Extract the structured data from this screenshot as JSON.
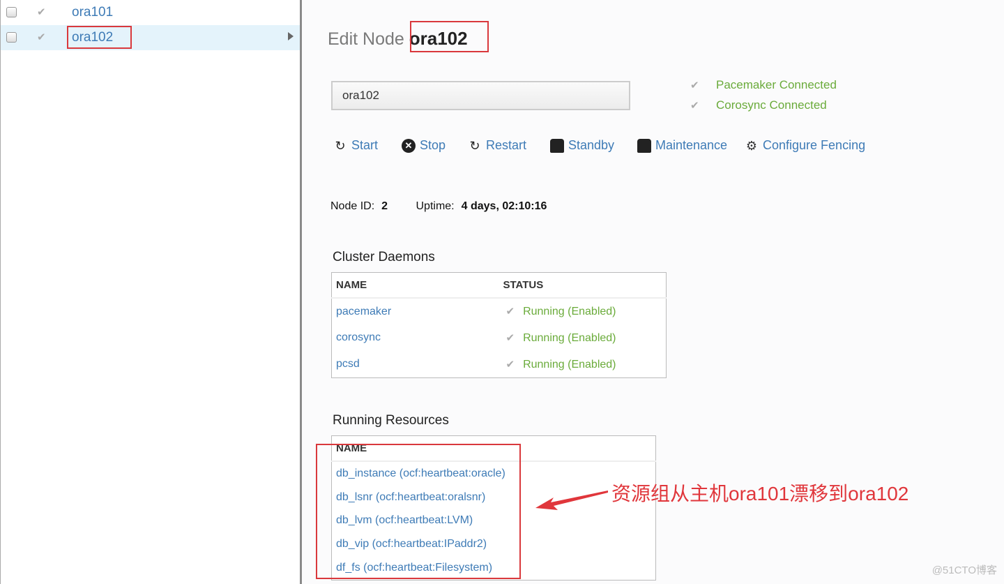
{
  "sidebar": {
    "nodes": [
      {
        "name": "ora101",
        "selected": false
      },
      {
        "name": "ora102",
        "selected": true
      }
    ]
  },
  "header": {
    "prefix": "Edit Node",
    "node": "ora102"
  },
  "node_name_input": {
    "value": "ora102"
  },
  "connection": [
    "Pacemaker Connected",
    "Corosync Connected"
  ],
  "actions": [
    {
      "label": "Start",
      "icon": "refresh-icon"
    },
    {
      "label": "Stop",
      "icon": "x-circle-icon"
    },
    {
      "label": "Restart",
      "icon": "refresh-icon"
    },
    {
      "label": "Standby",
      "icon": "standby-icon"
    },
    {
      "label": "Maintenance",
      "icon": "maintenance-icon"
    },
    {
      "label": "Configure Fencing",
      "icon": "gears-icon"
    }
  ],
  "info": {
    "node_id_label": "Node ID:",
    "node_id": "2",
    "uptime_label": "Uptime:",
    "uptime": "4 days, 02:10:16"
  },
  "daemons": {
    "title": "Cluster Daemons",
    "headers": [
      "NAME",
      "STATUS"
    ],
    "rows": [
      [
        "pacemaker",
        "Running (Enabled)"
      ],
      [
        "corosync",
        "Running (Enabled)"
      ],
      [
        "pcsd",
        "Running (Enabled)"
      ]
    ]
  },
  "resources": {
    "title": "Running Resources",
    "header": "NAME",
    "rows": [
      "db_instance (ocf:heartbeat:oracle)",
      "db_lsnr (ocf:heartbeat:oralsnr)",
      "db_lvm (ocf:heartbeat:LVM)",
      "db_vip (ocf:heartbeat:IPaddr2)",
      "df_fs (ocf:heartbeat:Filesystem)"
    ]
  },
  "annotation": "资源组从主机ora101漂移到ora102",
  "watermark": "@51CTO博客",
  "colors": {
    "link": "#3e7bb6",
    "ok": "#6aab3a",
    "annotation": "#e0363b"
  }
}
